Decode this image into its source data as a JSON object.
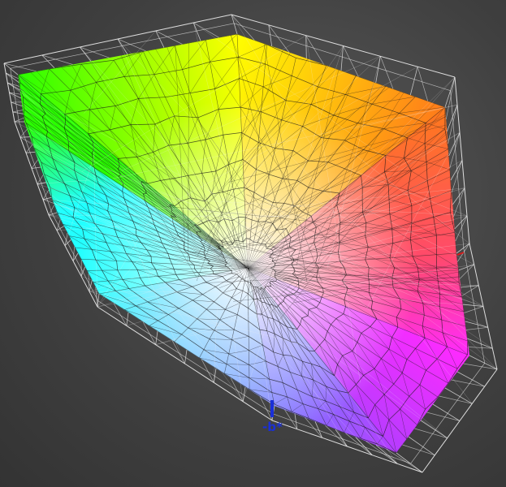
{
  "axes": {
    "b_negative_label": "-b*",
    "b_axis_color": "#1a2fd8",
    "a_axis_color": "#d81a1a"
  },
  "gamut_colors": {
    "green": "#2aff00",
    "yellow": "#ffff00",
    "orange": "#ff7a1a",
    "red": "#ff4a6a",
    "magenta": "#ff2aff",
    "violet": "#b63cff",
    "blue": "#7a7aff",
    "cyan": "#22ffff",
    "white": "#ffffff"
  },
  "wireframe": {
    "inner_color": "#1a1a1a",
    "outer_color": "#eeeeee"
  },
  "background": {
    "color": "#444444"
  }
}
